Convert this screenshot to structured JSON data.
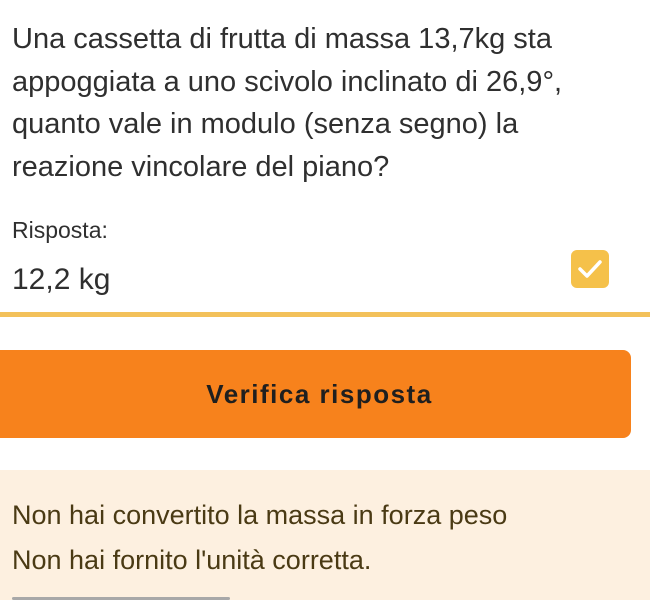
{
  "question": {
    "text": "Una cassetta di frutta di massa 13,7kg sta appoggiata a uno scivolo inclinato di 26,9°, quanto vale in modulo (senza segno) la reazione vincolare del piano?"
  },
  "answer": {
    "label": "Risposta:",
    "value": "12,2 kg",
    "status_icon": "checkmark-icon",
    "status_color": "#f5c14a",
    "underline_color": "#f3c15a"
  },
  "verify_button": {
    "label": "Verifica risposta",
    "color": "#f7821c"
  },
  "feedback": {
    "background": "#fdf0e0",
    "messages": [
      "Non hai convertito la massa in forza peso",
      "Non hai fornito l'unità corretta."
    ]
  }
}
